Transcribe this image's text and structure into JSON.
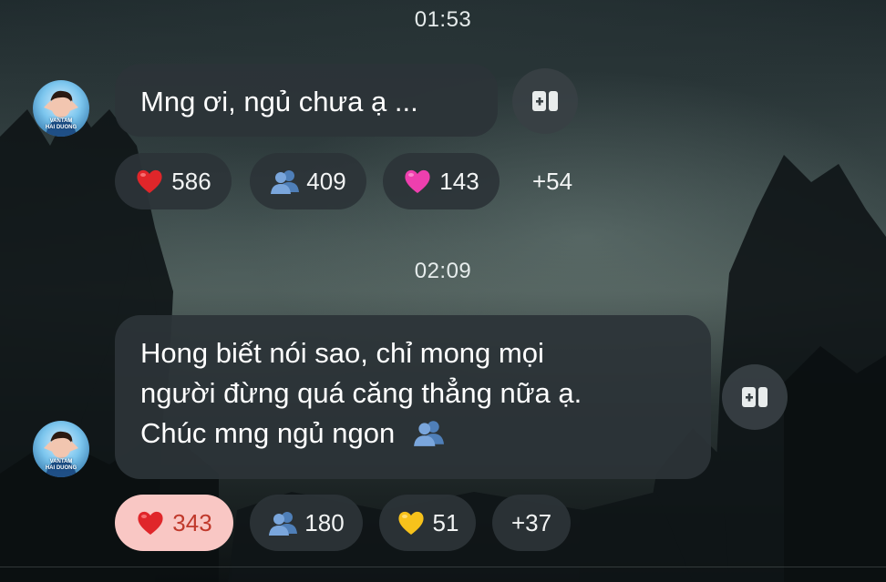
{
  "messages": [
    {
      "time": "01:53",
      "author_badge": [
        "VANTAM",
        "HAI DUONG"
      ],
      "lines": [
        "Mng ơi, ngủ chưa ạ ..."
      ],
      "reactions": [
        {
          "icon": "red-heart-icon",
          "count": "586",
          "active": false
        },
        {
          "icon": "busts-in-silhouette-icon",
          "count": "409",
          "active": false
        },
        {
          "icon": "pink-heart-icon",
          "count": "143",
          "active": false
        },
        {
          "icon": "more",
          "count": "+54",
          "active": false
        }
      ]
    },
    {
      "time": "02:09",
      "author_badge": [
        "VANTAM",
        "HAI DUONG"
      ],
      "lines": [
        "Hong biết nói sao, chỉ mong mọi",
        "người đừng quá căng thẳng nữa ạ.",
        "Chúc mng ngủ ngon"
      ],
      "trailing_emoji": "busts-in-silhouette-icon",
      "reactions": [
        {
          "icon": "red-heart-icon",
          "count": "343",
          "active": true
        },
        {
          "icon": "busts-in-silhouette-icon",
          "count": "180",
          "active": false
        },
        {
          "icon": "yellow-heart-icon",
          "count": "51",
          "active": false
        },
        {
          "icon": "more",
          "count": "+37",
          "active": false
        }
      ]
    }
  ],
  "colors": {
    "bubble": "#2c3438",
    "active_reaction_bg": "#f9c7c4",
    "active_reaction_text": "#c0392b",
    "red_heart": "#e0262a",
    "pink_heart": "#ee3fae",
    "yellow_heart": "#f7c21b",
    "busts": "#6d9ad1"
  }
}
